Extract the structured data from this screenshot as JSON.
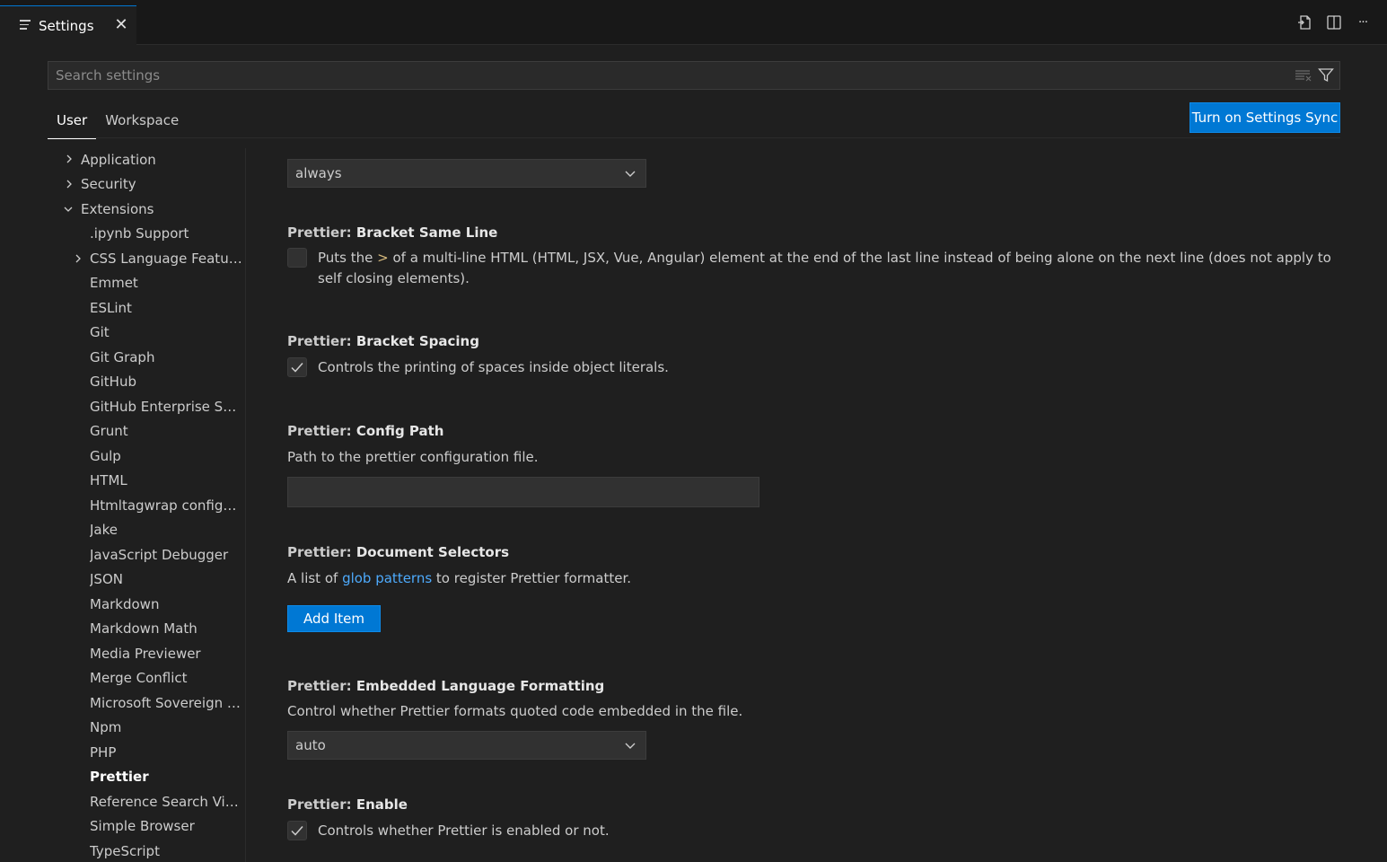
{
  "tab": {
    "title": "Settings",
    "close_glyph": "✕",
    "icon": "list-icon"
  },
  "actions": {
    "open_json_icon": "open-json-icon",
    "split_icon": "split-editor-icon",
    "more": "···"
  },
  "search": {
    "placeholder": "Search settings"
  },
  "scope": {
    "user": "User",
    "workspace": "Workspace"
  },
  "sync_button": "Turn on Settings Sync",
  "toc": [
    "Application",
    "Security",
    "Extensions",
    ".ipynb Support",
    "CSS Language Features",
    "Emmet",
    "ESLint",
    "Git",
    "Git Graph",
    "GitHub",
    "GitHub Enterprise Ser...",
    "Grunt",
    "Gulp",
    "HTML",
    "Htmltagwrap configur...",
    "Jake",
    "JavaScript Debugger",
    "JSON",
    "Markdown",
    "Markdown Math",
    "Media Previewer",
    "Merge Conflict",
    "Microsoft Sovereign C...",
    "Npm",
    "PHP",
    "Prettier",
    "Reference Search View",
    "Simple Browser",
    "TypeScript"
  ],
  "settings": {
    "top_select_value": "always",
    "bracket_same_line": {
      "category": "Prettier: ",
      "name": "Bracket Same Line",
      "desc_pre": "Puts the ",
      "desc_code": ">",
      "desc_post": " of a multi-line HTML (HTML, JSX, Vue, Angular) element at the end of the last line instead of being alone on the next line (does not apply to self closing elements).",
      "checked": false
    },
    "bracket_spacing": {
      "category": "Prettier: ",
      "name": "Bracket Spacing",
      "desc": "Controls the printing of spaces inside object literals.",
      "checked": true
    },
    "config_path": {
      "category": "Prettier: ",
      "name": "Config Path",
      "desc": "Path to the prettier configuration file.",
      "value": ""
    },
    "document_selectors": {
      "category": "Prettier: ",
      "name": "Document Selectors",
      "desc_pre": "A list of ",
      "desc_link": "glob patterns",
      "desc_post": " to register Prettier formatter.",
      "button": "Add Item"
    },
    "embedded_language": {
      "category": "Prettier: ",
      "name": "Embedded Language Formatting",
      "desc": "Control whether Prettier formats quoted code embedded in the file.",
      "value": "auto"
    },
    "enable": {
      "category": "Prettier: ",
      "name": "Enable",
      "desc": "Controls whether Prettier is enabled or not.",
      "checked": true
    }
  }
}
